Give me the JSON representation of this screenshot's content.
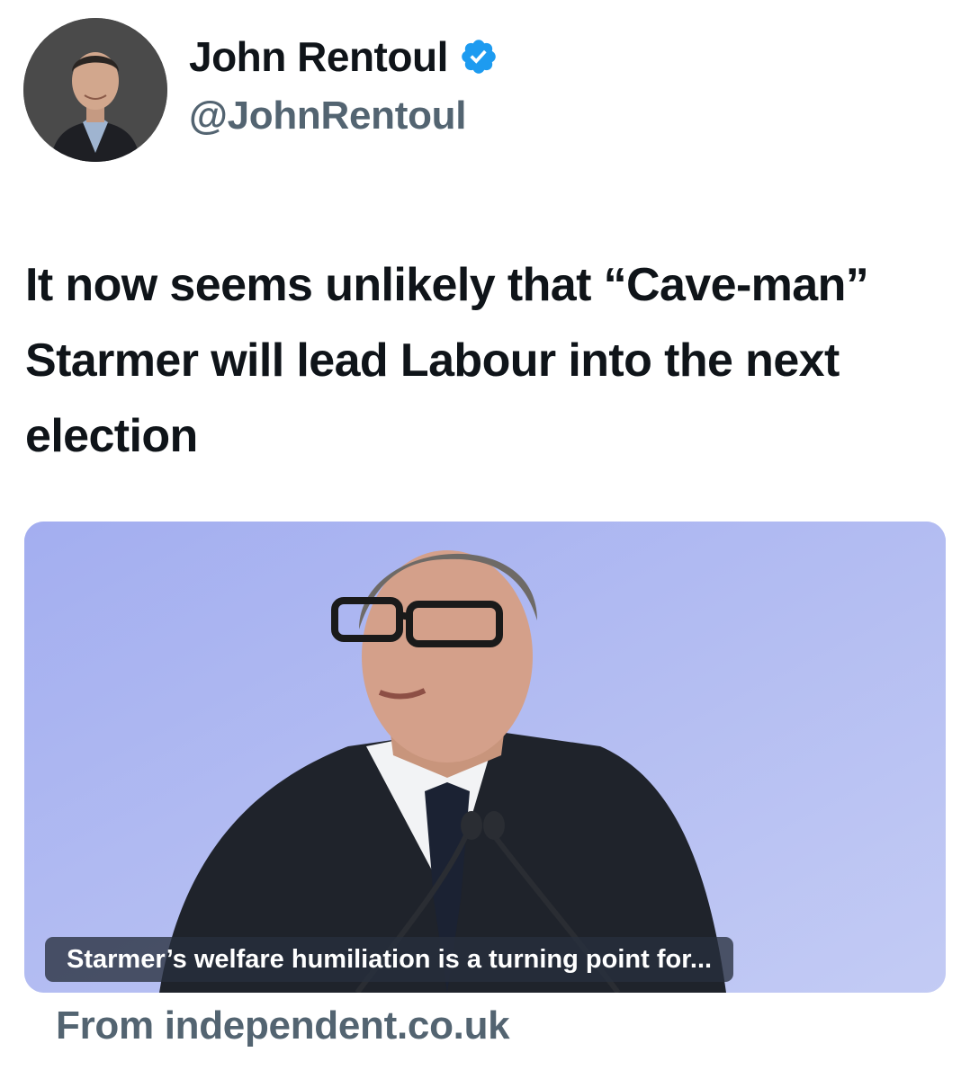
{
  "author": {
    "display_name": "John Rentoul",
    "handle": "@JohnRentoul",
    "verified_icon": "verified-badge-icon",
    "verified_color": "#1d9bf0"
  },
  "tweet": {
    "text": "It now seems unlikely that “Cave-man” Starmer will lead Labour into the next election"
  },
  "link_card": {
    "headline": "Starmer’s welfare humiliation is a turning point for...",
    "source": "From independent.co.uk"
  },
  "colors": {
    "text_primary": "#0f1419",
    "text_secondary": "#536471",
    "card_background": "#aeb8f1"
  }
}
